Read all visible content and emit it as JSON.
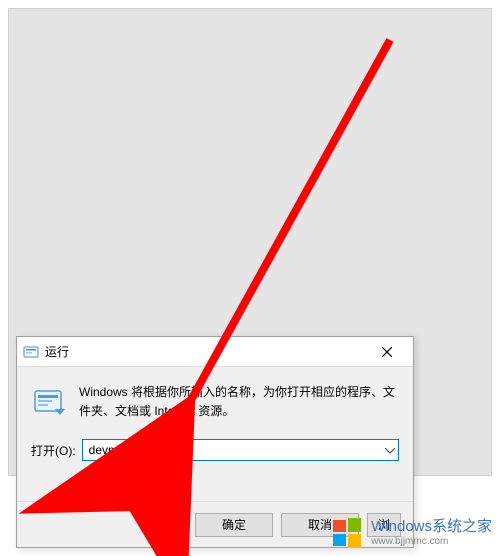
{
  "dialog": {
    "title": "运行",
    "description": "Windows 将根据你所输入的名称，为你打开相应的程序、文件夹、文档或 Internet 资源。",
    "open_label": "打开(O):",
    "input_value": "devmgmt.msc",
    "buttons": {
      "ok": "确定",
      "cancel": "取消",
      "browse_partial": "浏"
    }
  },
  "watermark": {
    "main": "Windows系统之家",
    "sub": "www.bjjmmc.com"
  },
  "colors": {
    "arrow": "#ff0000",
    "accent": "#0078d7"
  }
}
